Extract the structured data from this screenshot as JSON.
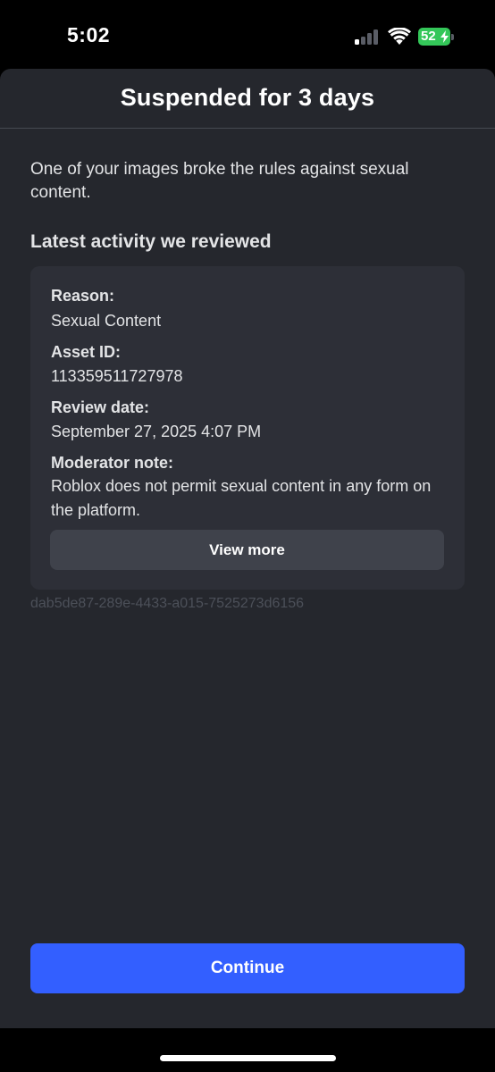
{
  "status_bar": {
    "time": "5:02",
    "battery_percent": "52",
    "signal_bars_active": 1,
    "signal_bars_total": 4,
    "battery_color": "#34c759"
  },
  "sheet": {
    "title": "Suspended for 3 days",
    "intro": "One of your images broke the rules against sexual content.",
    "section_heading": "Latest activity we reviewed"
  },
  "review": {
    "reason_label": "Reason:",
    "reason_value": "Sexual Content",
    "asset_label": "Asset ID:",
    "asset_value": "113359511727978",
    "date_label": "Review date:",
    "date_value": "September 27, 2025 4:07 PM",
    "note_label": "Moderator note:",
    "note_value": "Roblox does not permit sexual content in any form on the platform.",
    "view_more_label": "View more"
  },
  "ticket_id": "dab5de87-289e-4433-a015-7525273d6156",
  "continue_label": "Continue",
  "colors": {
    "sheet_background": "#25272d",
    "card_background": "#2d2f37",
    "primary_button": "#335fff",
    "secondary_button": "#3f424b"
  },
  "icons": {
    "signal": "cellular-signal-icon",
    "wifi": "wifi-icon",
    "battery": "battery-charging-icon"
  }
}
